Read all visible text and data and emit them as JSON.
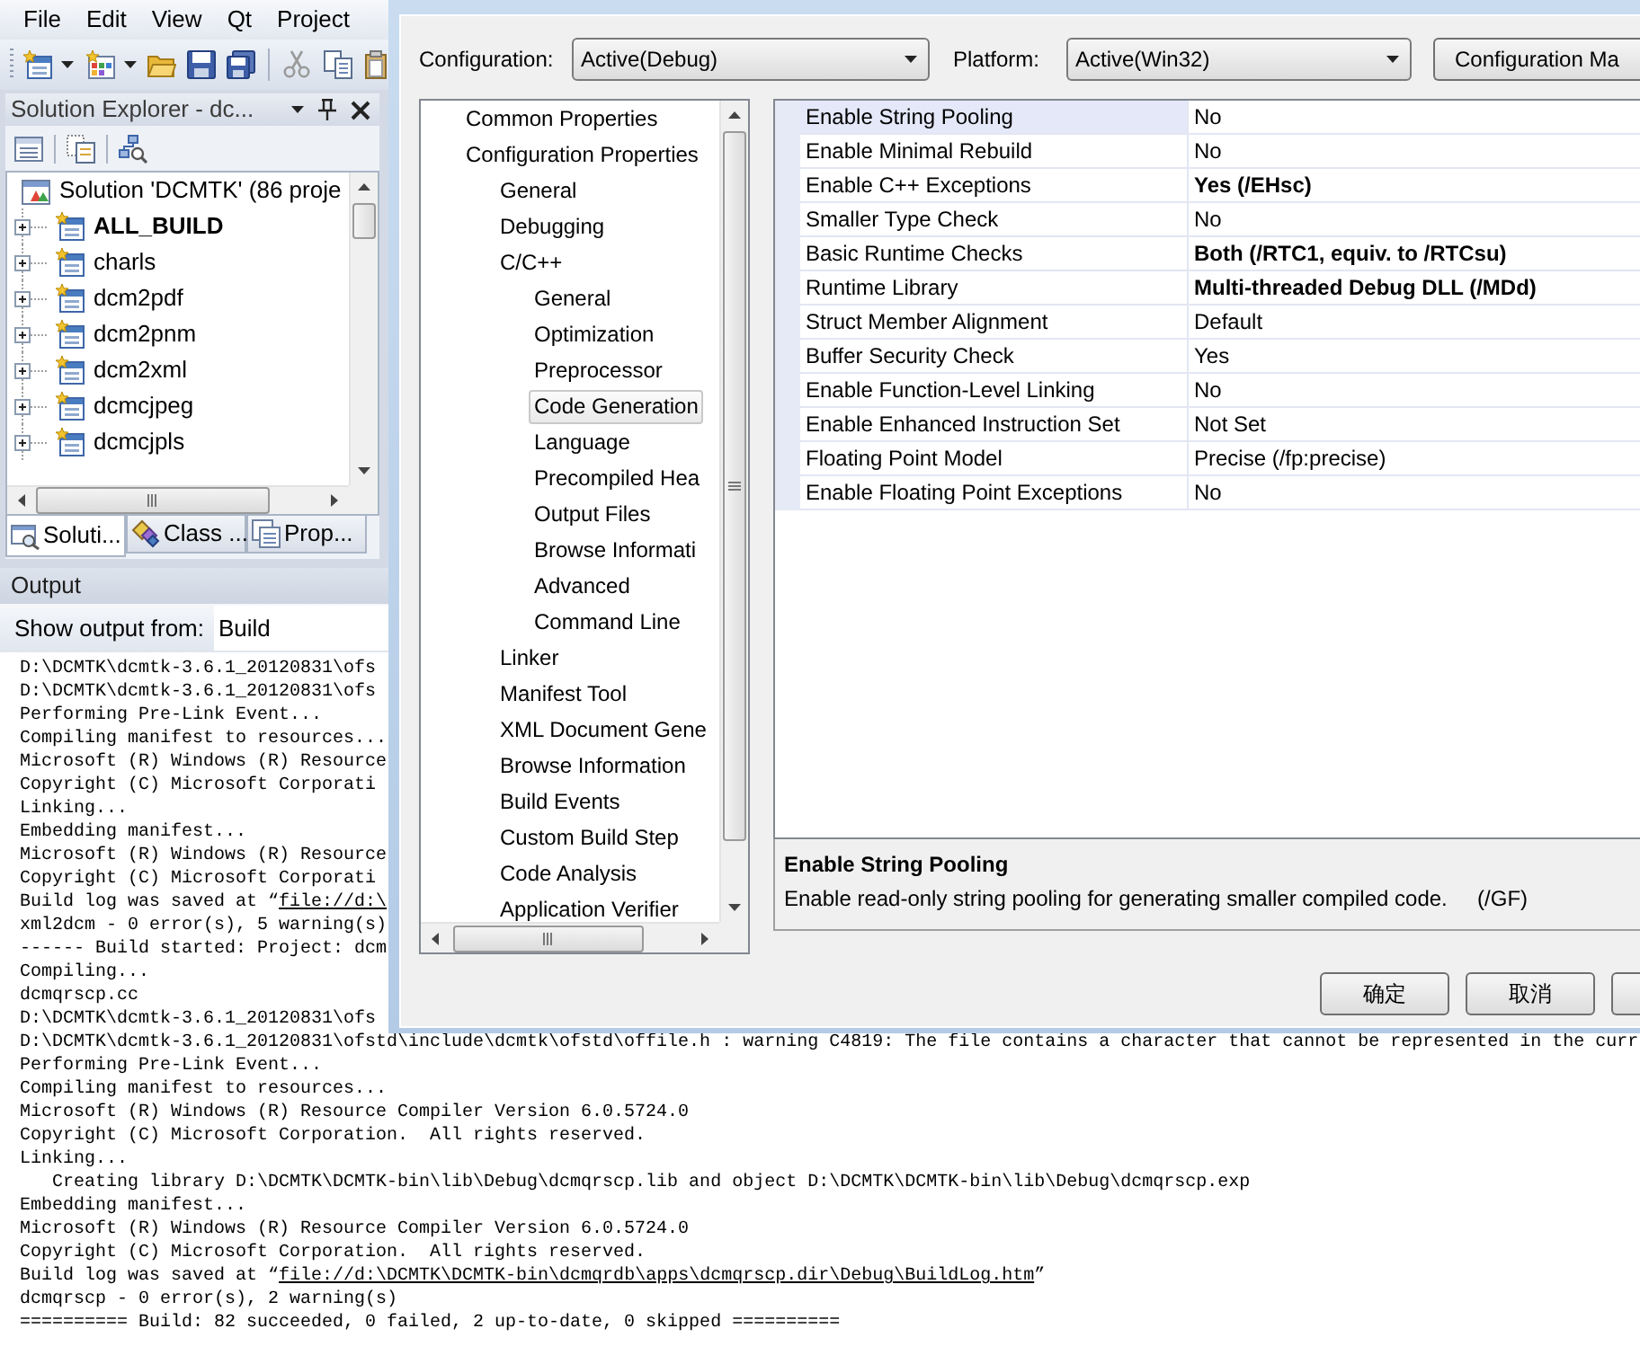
{
  "menu_bar": {
    "items": [
      "File",
      "Edit",
      "View",
      "Qt",
      "Project"
    ]
  },
  "solution_explorer": {
    "title": "Solution Explorer - dc...",
    "solution": "Solution 'DCMTK' (86 proje",
    "projects": [
      {
        "name": "ALL_BUILD",
        "startup": true
      },
      {
        "name": "charls",
        "startup": false
      },
      {
        "name": "dcm2pdf",
        "startup": false
      },
      {
        "name": "dcm2pnm",
        "startup": false
      },
      {
        "name": "dcm2xml",
        "startup": false
      },
      {
        "name": "dcmcjpeg",
        "startup": false
      },
      {
        "name": "dcmcjpls",
        "startup": false
      }
    ],
    "tabs": [
      {
        "label": "Soluti...",
        "selected": true
      },
      {
        "label": "Class ...",
        "selected": false
      },
      {
        "label": "Prop...",
        "selected": false
      }
    ]
  },
  "output": {
    "title": "Output",
    "source_label": "Show output from:",
    "source_value": "Build",
    "lines": [
      {
        "text": "D:\\DCMTK\\dcmtk-3.6.1_20120831\\ofs"
      },
      {
        "text": "D:\\DCMTK\\dcmtk-3.6.1_20120831\\ofs"
      },
      {
        "text": "Performing Pre-Link Event..."
      },
      {
        "text": "Compiling manifest to resources..."
      },
      {
        "text": "Microsoft (R) Windows (R) Resource"
      },
      {
        "text": "Copyright (C) Microsoft Corporati"
      },
      {
        "text": "Linking..."
      },
      {
        "text": "Embedding manifest..."
      },
      {
        "text": "Microsoft (R) Windows (R) Resource"
      },
      {
        "text": "Copyright (C) Microsoft Corporati"
      },
      {
        "text": "Build log was saved at “",
        "link": "file://d:\\"
      },
      {
        "text": "xml2dcm - 0 error(s), 5 warning(s)"
      },
      {
        "text": "------ Build started: Project: dcm"
      },
      {
        "text": "Compiling..."
      },
      {
        "text": "dcmqrscp.cc"
      },
      {
        "text": "D:\\DCMTK\\dcmtk-3.6.1_20120831\\ofs"
      },
      {
        "text": "D:\\DCMTK\\dcmtk-3.6.1_20120831\\ofstd\\include\\dcmtk\\ofstd\\offile.h : warning C4819: The file contains a character that cannot be represented in the curr"
      },
      {
        "text": "Performing Pre-Link Event..."
      },
      {
        "text": "Compiling manifest to resources..."
      },
      {
        "text": "Microsoft (R) Windows (R) Resource Compiler Version 6.0.5724.0"
      },
      {
        "text": "Copyright (C) Microsoft Corporation.  All rights reserved."
      },
      {
        "text": "Linking..."
      },
      {
        "text": "   Creating library D:\\DCMTK\\DCMTK-bin\\lib\\Debug\\dcmqrscp.lib and object D:\\DCMTK\\DCMTK-bin\\lib\\Debug\\dcmqrscp.exp"
      },
      {
        "text": "Embedding manifest..."
      },
      {
        "text": "Microsoft (R) Windows (R) Resource Compiler Version 6.0.5724.0"
      },
      {
        "text": "Copyright (C) Microsoft Corporation.  All rights reserved."
      },
      {
        "text": "Build log was saved at “",
        "link": "file://d:\\DCMTK\\DCMTK-bin\\dcmqrdb\\apps\\dcmqrscp.dir\\Debug\\BuildLog.htm",
        "after": "”"
      },
      {
        "text": "dcmqrscp - 0 error(s), 2 warning(s)"
      },
      {
        "text": "========== Build: 82 succeeded, 0 failed, 2 up-to-date, 0 skipped =========="
      }
    ]
  },
  "dialog": {
    "configuration_label": "Configuration:",
    "configuration": "Active(Debug)",
    "platform_label": "Platform:",
    "platform": "Active(Win32)",
    "manager_button": "Configuration Ma",
    "tree": [
      {
        "label": "Common Properties",
        "selected": false
      },
      {
        "label": "Configuration Properties",
        "selected": false,
        "children": [
          {
            "label": "General",
            "selected": false
          },
          {
            "label": "Debugging",
            "selected": false
          },
          {
            "label": "C/C++",
            "selected": false,
            "children": [
              {
                "label": "General",
                "selected": false
              },
              {
                "label": "Optimization",
                "selected": false
              },
              {
                "label": "Preprocessor",
                "selected": false
              },
              {
                "label": "Code Generation",
                "selected": true
              },
              {
                "label": "Language",
                "selected": false
              },
              {
                "label": "Precompiled Hea",
                "selected": false
              },
              {
                "label": "Output Files",
                "selected": false
              },
              {
                "label": "Browse Informati",
                "selected": false
              },
              {
                "label": "Advanced",
                "selected": false
              },
              {
                "label": "Command Line",
                "selected": false
              }
            ]
          },
          {
            "label": "Linker",
            "selected": false
          },
          {
            "label": "Manifest Tool",
            "selected": false
          },
          {
            "label": "XML Document Gene",
            "selected": false
          },
          {
            "label": "Browse Information",
            "selected": false
          },
          {
            "label": "Build Events",
            "selected": false
          },
          {
            "label": "Custom Build Step",
            "selected": false
          },
          {
            "label": "Code Analysis",
            "selected": false
          },
          {
            "label": "Application Verifier",
            "selected": false
          }
        ]
      }
    ],
    "properties": [
      {
        "name": "Enable String Pooling",
        "value": "No",
        "selected": true,
        "modified": false
      },
      {
        "name": "Enable Minimal Rebuild",
        "value": "No",
        "selected": false,
        "modified": false
      },
      {
        "name": "Enable C++ Exceptions",
        "value": "Yes (/EHsc)",
        "selected": false,
        "modified": true
      },
      {
        "name": "Smaller Type Check",
        "value": "No",
        "selected": false,
        "modified": false
      },
      {
        "name": "Basic Runtime Checks",
        "value": "Both (/RTC1, equiv. to /RTCsu)",
        "selected": false,
        "modified": true
      },
      {
        "name": "Runtime Library",
        "value": "Multi-threaded Debug DLL (/MDd)",
        "selected": false,
        "modified": true
      },
      {
        "name": "Struct Member Alignment",
        "value": "Default",
        "selected": false,
        "modified": false
      },
      {
        "name": "Buffer Security Check",
        "value": "Yes",
        "selected": false,
        "modified": false
      },
      {
        "name": "Enable Function-Level Linking",
        "value": "No",
        "selected": false,
        "modified": false
      },
      {
        "name": "Enable Enhanced Instruction Set",
        "value": "Not Set",
        "selected": false,
        "modified": false
      },
      {
        "name": "Floating Point Model",
        "value": "Precise (/fp:precise)",
        "selected": false,
        "modified": false
      },
      {
        "name": "Enable Floating Point Exceptions",
        "value": "No",
        "selected": false,
        "modified": false
      }
    ],
    "description": {
      "title": "Enable String Pooling",
      "text": "Enable read-only string pooling for generating smaller compiled code.     (/GF)"
    },
    "buttons": [
      "确定",
      "取消"
    ]
  }
}
